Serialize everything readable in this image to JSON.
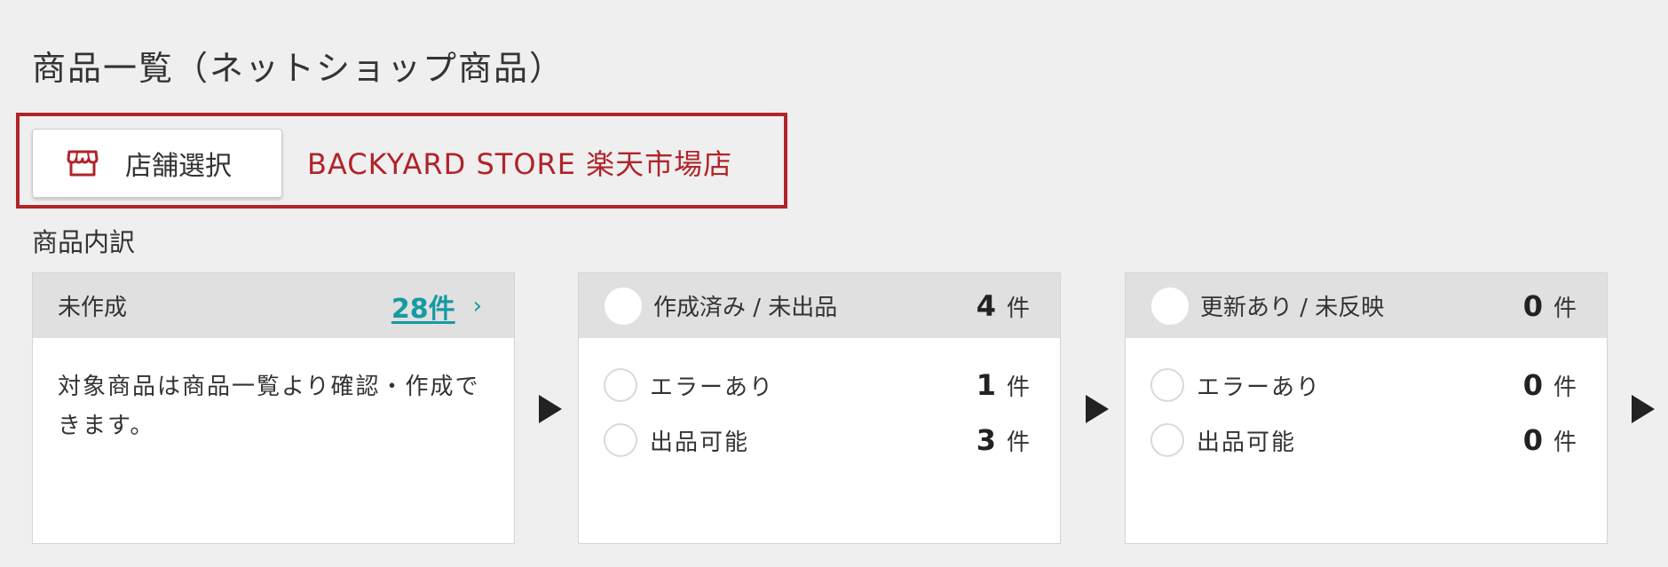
{
  "page": {
    "title": "商品一覧（ネットショップ商品）"
  },
  "store": {
    "select_button_label": "店舗選択",
    "selected_store_name": "BACKYARD STORE 楽天市場店"
  },
  "breakdown": {
    "section_label": "商品内訳",
    "cards": [
      {
        "title": "未作成",
        "count": "28件",
        "chevron": "›",
        "description": "対象商品は商品一覧より確認・作成できます。"
      },
      {
        "title": "作成済み / 未出品",
        "count": "4",
        "unit": "件",
        "rows": [
          {
            "label": "エラーあり",
            "count": "1",
            "unit": "件"
          },
          {
            "label": "出品可能",
            "count": "3",
            "unit": "件"
          }
        ]
      },
      {
        "title": "更新あり / 未反映",
        "count": "0",
        "unit": "件",
        "rows": [
          {
            "label": "エラーあり",
            "count": "0",
            "unit": "件"
          },
          {
            "label": "出品可能",
            "count": "0",
            "unit": "件"
          }
        ]
      }
    ]
  },
  "colors": {
    "accent_red": "#b0242a",
    "link_teal": "#169aa3",
    "header_gray": "#e0e0e0",
    "background": "#efefef"
  },
  "icons": {
    "store_icon": "store-icon",
    "arrow_icon": "arrow-right-icon",
    "chevron_icon": "chevron-right-icon"
  }
}
